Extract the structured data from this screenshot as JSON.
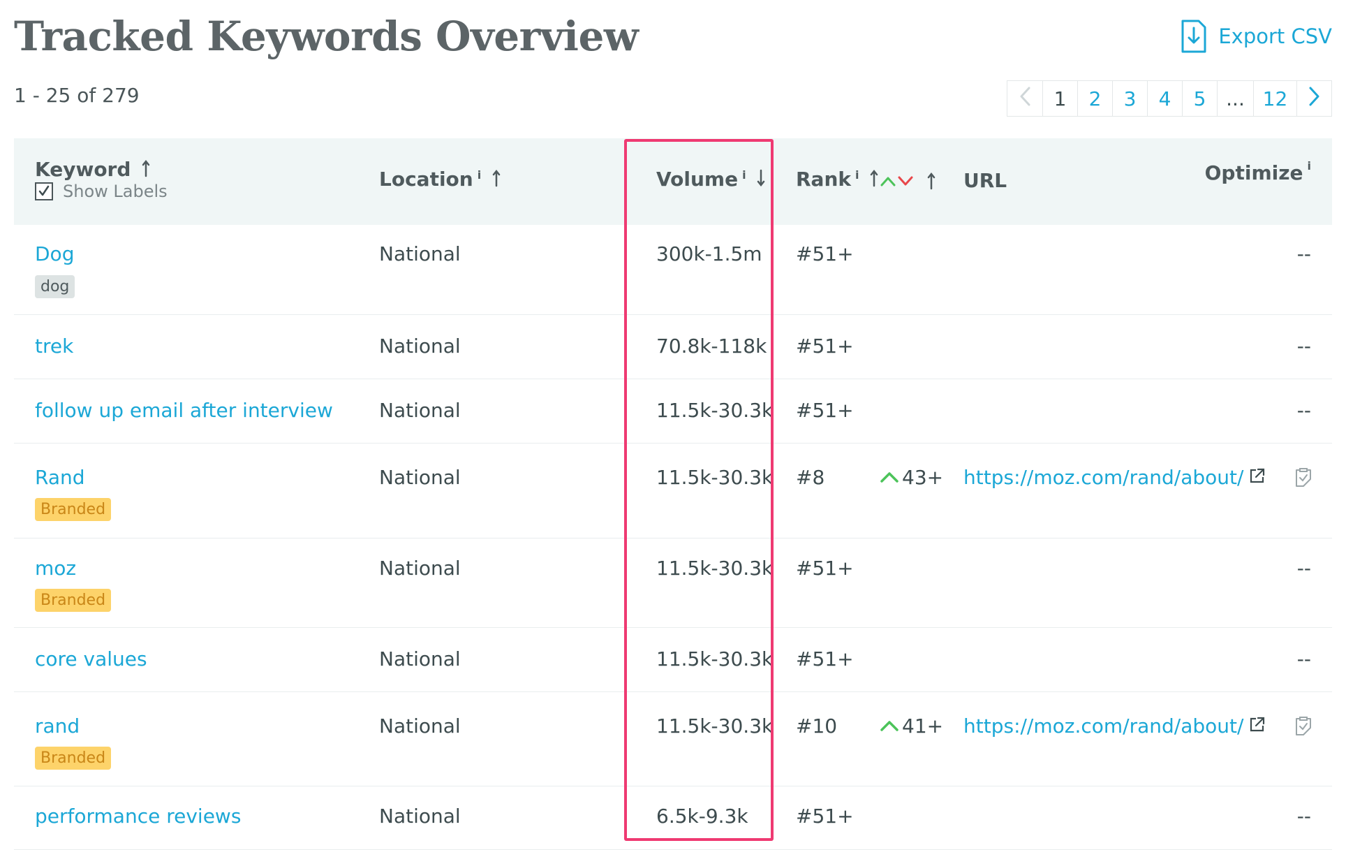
{
  "header": {
    "title": "Tracked Keywords Overview",
    "export_label": "Export CSV"
  },
  "results": {
    "range_text": "1 - 25 of 279"
  },
  "pagination": {
    "pages": [
      "1",
      "2",
      "3",
      "4",
      "5",
      "...",
      "12"
    ],
    "current": "1"
  },
  "table": {
    "columns": {
      "keyword": "Keyword",
      "show_labels": "Show Labels",
      "location": "Location",
      "volume": "Volume",
      "rank": "Rank",
      "url": "URL",
      "optimize": "Optimize",
      "info_mark": "i"
    },
    "rows": [
      {
        "keyword": "Dog",
        "label": "dog",
        "location": "National",
        "volume": "300k-1.5m",
        "rank": "#51+",
        "change": "",
        "url": "",
        "optimize": "--"
      },
      {
        "keyword": "trek",
        "label": "",
        "location": "National",
        "volume": "70.8k-118k",
        "rank": "#51+",
        "change": "",
        "url": "",
        "optimize": "--"
      },
      {
        "keyword": "follow up email after interview",
        "label": "",
        "location": "National",
        "volume": "11.5k-30.3k",
        "rank": "#51+",
        "change": "",
        "url": "",
        "optimize": "--"
      },
      {
        "keyword": "Rand",
        "label": "Branded",
        "location": "National",
        "volume": "11.5k-30.3k",
        "rank": "#8",
        "change": "43+",
        "url": "https://moz.com/rand/about/",
        "optimize": ""
      },
      {
        "keyword": "moz",
        "label": "Branded",
        "location": "National",
        "volume": "11.5k-30.3k",
        "rank": "#51+",
        "change": "",
        "url": "",
        "optimize": "--"
      },
      {
        "keyword": "core values",
        "label": "",
        "location": "National",
        "volume": "11.5k-30.3k",
        "rank": "#51+",
        "change": "",
        "url": "",
        "optimize": "--"
      },
      {
        "keyword": "rand",
        "label": "Branded",
        "location": "National",
        "volume": "11.5k-30.3k",
        "rank": "#10",
        "change": "41+",
        "url": "https://moz.com/rand/about/",
        "optimize": ""
      },
      {
        "keyword": "performance reviews",
        "label": "",
        "location": "National",
        "volume": "6.5k-9.3k",
        "rank": "#51+",
        "change": "",
        "url": "",
        "optimize": "--"
      }
    ]
  },
  "colors": {
    "accent": "#1ba7d6",
    "highlight": "#ef3a72",
    "up": "#4cc35a",
    "down": "#e8474a",
    "branded_bg": "#fdd36a"
  },
  "icons": {
    "export": "download-file-icon",
    "prev": "chevron-left-icon",
    "next": "chevron-right-icon",
    "external": "external-link-icon",
    "optimize": "clipboard-check-icon"
  }
}
